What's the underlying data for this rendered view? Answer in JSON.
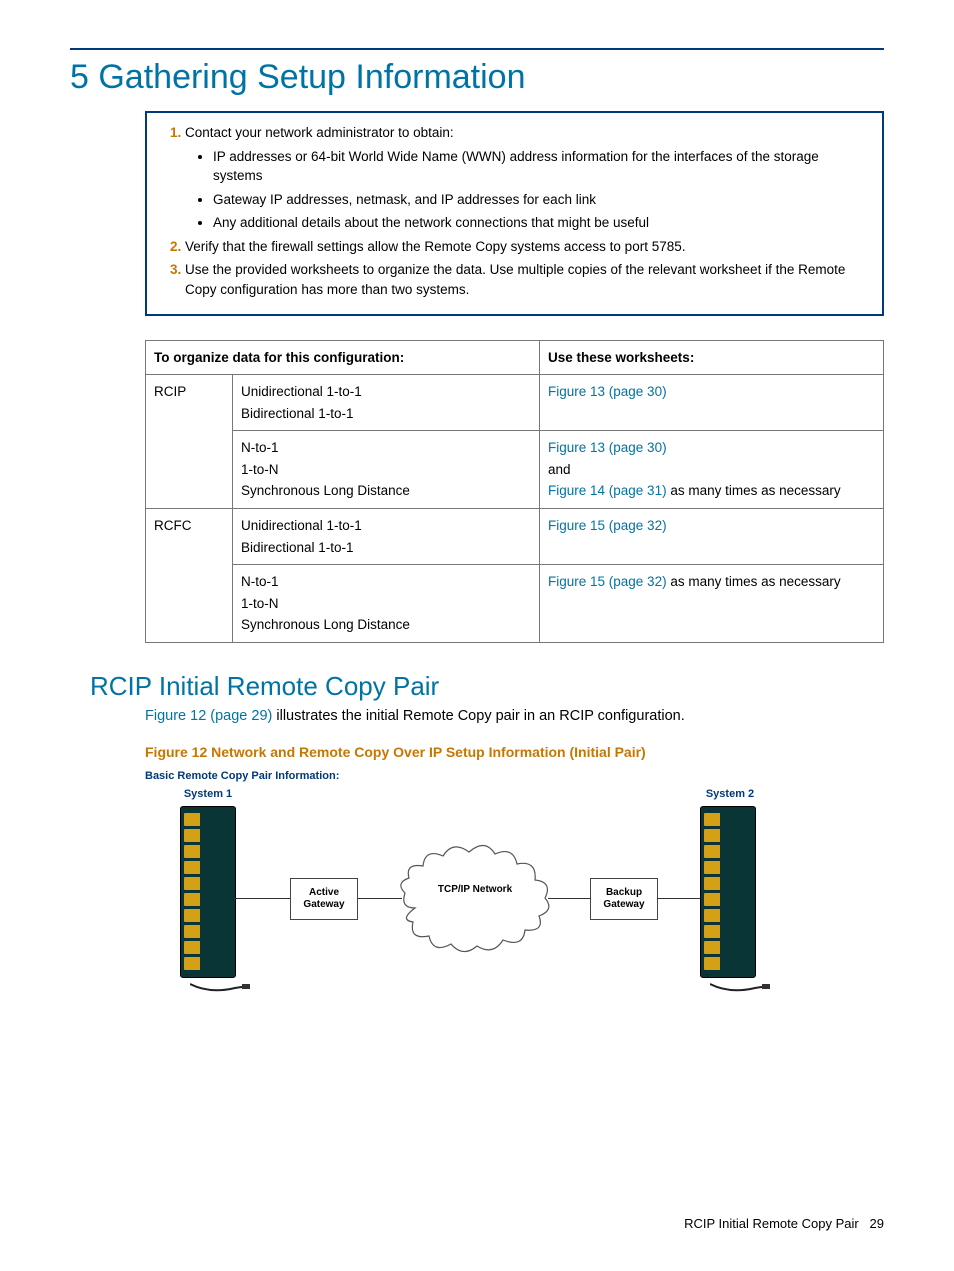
{
  "title": "5 Gathering Setup Information",
  "instructions": {
    "item1": {
      "lead": "Contact your network administrator to obtain:",
      "bullets": [
        "IP addresses or 64-bit World Wide Name (WWN) address information for the interfaces of the storage systems",
        "Gateway IP addresses, netmask, and IP addresses for each link",
        "Any additional details about the network connections that might be useful"
      ]
    },
    "item2": "Verify that the firewall settings allow the Remote Copy systems access to port 5785.",
    "item3": "Use the provided worksheets to organize the data. Use multiple copies of the relevant worksheet if the Remote Copy configuration has more than two systems."
  },
  "table": {
    "header1": "To organize data for this configuration:",
    "header2": "Use these worksheets:",
    "rows": [
      {
        "col1": "RCIP",
        "col2a": "Unidirectional 1-to-1",
        "col2b": "Bidirectional 1-to-1",
        "col3_link": "Figure 13 (page 30)"
      },
      {
        "col2a": "N-to-1",
        "col2b": "1-to-N",
        "col2c": "Synchronous Long Distance",
        "col3_link1": "Figure 13 (page 30)",
        "col3_mid": "and",
        "col3_link2": "Figure 14 (page 31)",
        "col3_tail": " as many times as necessary"
      },
      {
        "col1": "RCFC",
        "col2a": "Unidirectional 1-to-1",
        "col2b": "Bidirectional 1-to-1",
        "col3_link": "Figure 15 (page 32)"
      },
      {
        "col2a": "N-to-1",
        "col2b": "1-to-N",
        "col2c": "Synchronous Long Distance",
        "col3_link": "Figure 15 (page 32)",
        "col3_tail": " as many times as necessary"
      }
    ]
  },
  "section": {
    "title": "RCIP Initial Remote Copy Pair",
    "body_link": "Figure 12 (page 29)",
    "body_rest": " illustrates the initial Remote Copy pair in an RCIP configuration."
  },
  "figure": {
    "caption": "Figure 12 Network and Remote Copy Over IP Setup Information (Initial Pair)",
    "subcaption": "Basic Remote Copy Pair Information:",
    "sys1": "System 1",
    "sys2": "System 2",
    "active_gw": "Active Gateway",
    "backup_gw": "Backup Gateway",
    "cloud": "TCP/IP Network"
  },
  "footer": {
    "text": "RCIP Initial Remote Copy Pair",
    "page": "29"
  }
}
